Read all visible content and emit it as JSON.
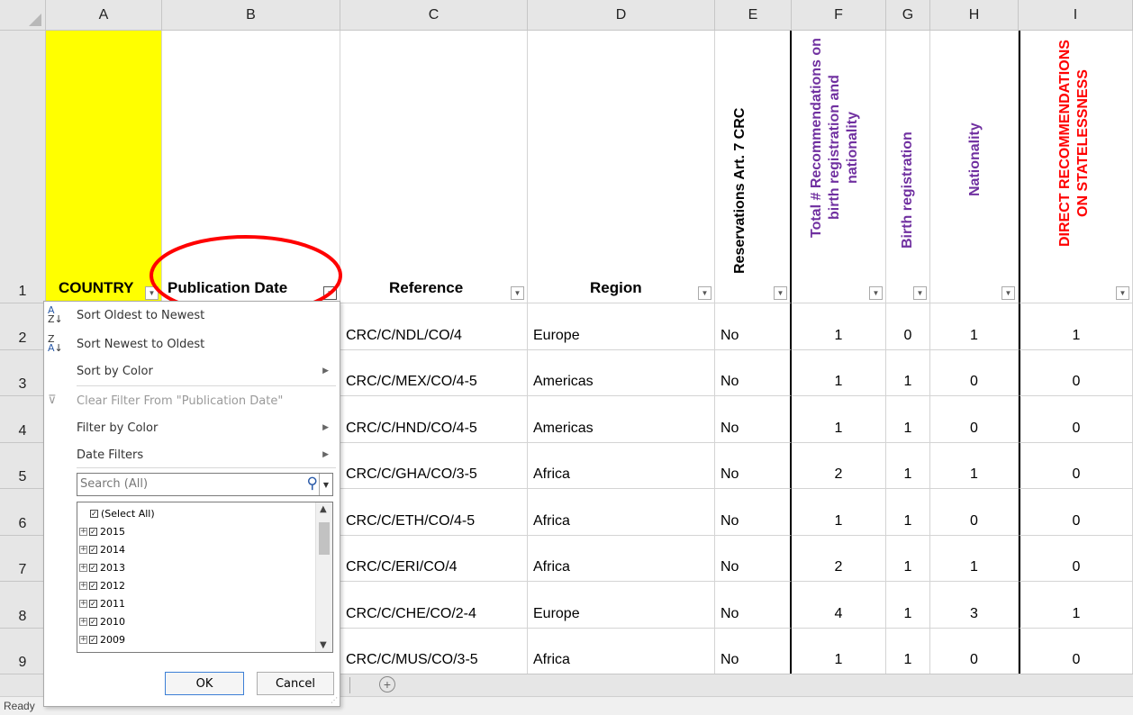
{
  "columns": [
    "A",
    "B",
    "C",
    "D",
    "E",
    "F",
    "G",
    "H",
    "I"
  ],
  "header_row": {
    "row_number": "1",
    "country": "COUNTRY",
    "publication_date": "Publication Date",
    "reference": "Reference",
    "region": "Region",
    "reservations": "Reservations Art. 7 CRC",
    "total_recs_line1": "Total # Recommendations on",
    "total_recs_line2": "birth registration and",
    "total_recs_line3": "nationality",
    "birth_registration": "Birth registration",
    "nationality": "Nationality",
    "direct_recs_line1": "DIRECT RECOMMENDATIONS",
    "direct_recs_line2": "ON STATELESSNESS"
  },
  "rows": [
    {
      "n": "2",
      "ref": "CRC/C/NDL/CO/4",
      "region": "Europe",
      "res": "No",
      "total": "1",
      "birth": "0",
      "nat": "1",
      "direct": "1"
    },
    {
      "n": "3",
      "ref": "CRC/C/MEX/CO/4-5",
      "region": "Americas",
      "res": "No",
      "total": "1",
      "birth": "1",
      "nat": "0",
      "direct": "0"
    },
    {
      "n": "4",
      "ref": "CRC/C/HND/CO/4-5",
      "region": "Americas",
      "res": "No",
      "total": "1",
      "birth": "1",
      "nat": "0",
      "direct": "0"
    },
    {
      "n": "5",
      "ref": "CRC/C/GHA/CO/3-5",
      "region": "Africa",
      "res": "No",
      "total": "2",
      "birth": "1",
      "nat": "1",
      "direct": "0"
    },
    {
      "n": "6",
      "ref": "CRC/C/ETH/CO/4-5",
      "region": "Africa",
      "res": "No",
      "total": "1",
      "birth": "1",
      "nat": "0",
      "direct": "0"
    },
    {
      "n": "7",
      "ref": "CRC/C/ERI/CO/4",
      "region": "Africa",
      "res": "No",
      "total": "2",
      "birth": "1",
      "nat": "1",
      "direct": "0"
    },
    {
      "n": "8",
      "ref": "CRC/C/CHE/CO/2-4",
      "region": "Europe",
      "res": "No",
      "total": "4",
      "birth": "1",
      "nat": "3",
      "direct": "1"
    },
    {
      "n": "9",
      "ref": "CRC/C/MUS/CO/3-5",
      "region": "Africa",
      "res": "No",
      "total": "1",
      "birth": "1",
      "nat": "0",
      "direct": "0"
    }
  ],
  "filter_menu": {
    "sort_oldest": "Sort Oldest to Newest",
    "sort_newest": "Sort Newest to Oldest",
    "sort_by_color": "Sort by Color",
    "clear_filter": "Clear Filter From \"Publication Date\"",
    "filter_by_color": "Filter by Color",
    "date_filters": "Date Filters",
    "search_placeholder": "Search (All)",
    "tree": [
      "(Select All)",
      "2015",
      "2014",
      "2013",
      "2012",
      "2011",
      "2010",
      "2009"
    ],
    "ok": "OK",
    "cancel": "Cancel"
  },
  "status": {
    "text": "Ready"
  },
  "colors": {
    "country_fill": "#ffff00",
    "purple_header": "#7030a0",
    "red_header": "#ff0000",
    "annotation": "#ff0000"
  }
}
